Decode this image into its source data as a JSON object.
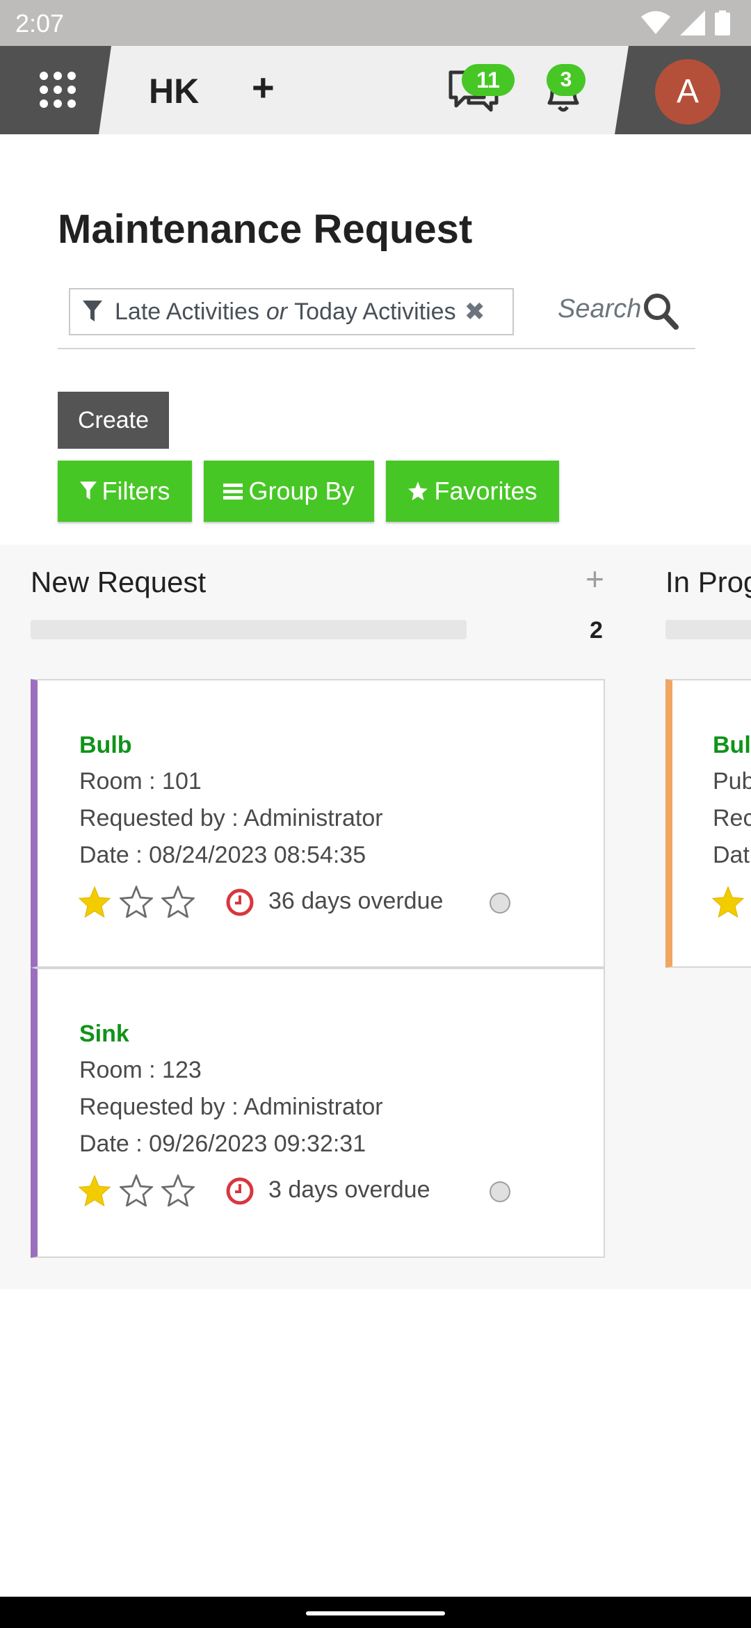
{
  "status_bar": {
    "time": "2:07"
  },
  "navbar": {
    "brand": "HK",
    "add_label": "+",
    "messages_count": "11",
    "notifications_count": "3",
    "avatar_initial": "A"
  },
  "page": {
    "title": "Maintenance Request"
  },
  "search": {
    "facet_part1": "Late Activities",
    "facet_or": "or",
    "facet_part2": "Today Activities",
    "facet_remove": "✖",
    "placeholder": "Search"
  },
  "buttons": {
    "create": "Create",
    "filters": "Filters",
    "group_by": "Group By",
    "favorites": "Favorites"
  },
  "columns": [
    {
      "title": "New Request",
      "add": "+",
      "count": "2",
      "accent": "#9b6ec0",
      "cards": [
        {
          "name": "Bulb",
          "room": "Room : 101",
          "requested_by": "Requested by : Administrator",
          "date": "Date : 08/24/2023 08:54:35",
          "priority_stars": 1,
          "overdue": "36 days overdue"
        },
        {
          "name": "Sink",
          "room": "Room : 123",
          "requested_by": "Requested by : Administrator",
          "date": "Date : 09/26/2023 09:32:31",
          "priority_stars": 1,
          "overdue": "3 days overdue"
        }
      ]
    },
    {
      "title": "In Prog",
      "accent": "#f0a562",
      "cards": [
        {
          "name": "Bul",
          "line1": "Pub",
          "line2": "Rec",
          "line3": "Dat",
          "priority_stars": 1
        }
      ]
    }
  ],
  "colors": {
    "green": "#47c725",
    "card_title_green": "#109319",
    "dark_button": "#545454",
    "overdue_red": "#d9363e",
    "star_yellow": "#f3cc00"
  }
}
